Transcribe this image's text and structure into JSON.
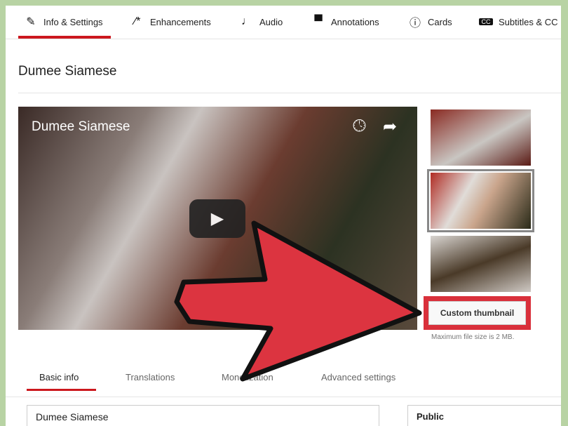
{
  "tabs": [
    {
      "label": "Info & Settings",
      "icon": "pencil-icon"
    },
    {
      "label": "Enhancements",
      "icon": "magic-wand-icon"
    },
    {
      "label": "Audio",
      "icon": "music-note-icon"
    },
    {
      "label": "Annotations",
      "icon": "speech-bubble-icon"
    },
    {
      "label": "Cards",
      "icon": "info-icon"
    },
    {
      "label": "Subtitles & CC",
      "icon": "cc-icon"
    }
  ],
  "title": "Dumee Siamese",
  "video": {
    "title": "Dumee Siamese",
    "icons": [
      "clock-icon",
      "share-icon",
      "play-icon"
    ]
  },
  "custom_thumbnail": "Custom thumbnail",
  "hint": "Maximum file size is 2 MB.",
  "subtabs": [
    "Basic info",
    "Translations",
    "Monetization",
    "Advanced settings"
  ],
  "fields": {
    "title_value": "Dumee Siamese",
    "privacy_value": "Public"
  },
  "colors": {
    "accent": "#cc181e",
    "highlight": "#d9303b",
    "arrow": "#dc3440",
    "background": "#b8d3a4"
  }
}
